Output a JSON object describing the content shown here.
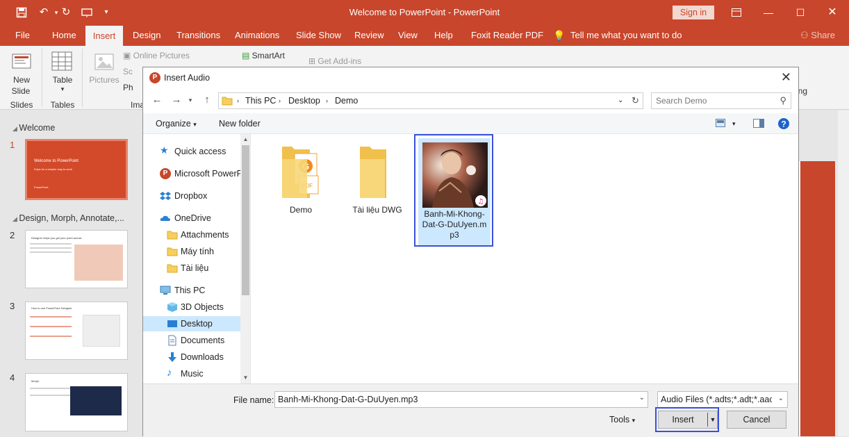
{
  "window": {
    "title": "Welcome to PowerPoint  -  PowerPoint",
    "sign_in": "Sign in"
  },
  "tabs": [
    "File",
    "Home",
    "Insert",
    "Design",
    "Transitions",
    "Animations",
    "Slide Show",
    "Review",
    "View",
    "Help",
    "Foxit Reader PDF",
    "Tell me what you want to do",
    "Share"
  ],
  "ribbon": {
    "new_slide": "New\nSlide",
    "new_slide_line1": "New",
    "new_slide_line2": "Slide",
    "slides_group": "Slides",
    "table": "Table",
    "tables_group": "Tables",
    "pictures": "Pictures",
    "online_pictures": "Online Pictures",
    "sc": "Sc",
    "ph": "Ph",
    "ima": "Ima",
    "smartart": "SmartArt",
    "get_addins": "Get Add-ins",
    "ing": "ing"
  },
  "slides_pane": {
    "sections": [
      "Welcome",
      "Design, Morph, Annotate,..."
    ],
    "slide_numbers": [
      "1",
      "2",
      "3",
      "4"
    ],
    "thumb1_title": "Welcome to PowerPoint",
    "thumb1_sub": "5 tips for a simpler way to work",
    "thumb1_logo": "PowerPoint",
    "thumb2_title": "Designer helps you get your point across",
    "thumb3_title": "How to use PowerPoint Designer",
    "thumb4_title": "Morph"
  },
  "dialog": {
    "title": "Insert Audio",
    "path": [
      "This PC",
      "Desktop",
      "Demo"
    ],
    "search_placeholder": "Search Demo",
    "organize": "Organize",
    "new_folder": "New folder",
    "nav": [
      {
        "label": "Quick access",
        "icon": "star-icon"
      },
      {
        "label": "Microsoft PowerP",
        "icon": "powerpoint-icon"
      },
      {
        "label": "Dropbox",
        "icon": "dropbox-icon"
      },
      {
        "label": "OneDrive",
        "icon": "cloud-icon"
      },
      {
        "label": "Attachments",
        "icon": "folder-icon"
      },
      {
        "label": "Máy tính",
        "icon": "folder-icon"
      },
      {
        "label": "Tài liệu",
        "icon": "folder-icon"
      },
      {
        "label": "This PC",
        "icon": "computer-icon"
      },
      {
        "label": "3D Objects",
        "icon": "cube-icon"
      },
      {
        "label": "Desktop",
        "icon": "desktop-icon"
      },
      {
        "label": "Documents",
        "icon": "document-icon"
      },
      {
        "label": "Downloads",
        "icon": "download-icon"
      },
      {
        "label": "Music",
        "icon": "music-icon"
      }
    ],
    "files": [
      {
        "name": "Demo",
        "type": "folder"
      },
      {
        "name": "Tài liệu DWG",
        "type": "folder"
      },
      {
        "name_lines": [
          "Banh-Mi-Khong-",
          "Dat-G-DuUyen.m",
          "p3"
        ],
        "type": "mp3"
      }
    ],
    "pdf_badge": "PDF",
    "file_name_label": "File name:",
    "file_name_value": "Banh-Mi-Khong-Dat-G-DuUyen.mp3",
    "file_type": "Audio Files (*.adts;*.adt;*.aac;*.",
    "tools": "Tools",
    "insert": "Insert",
    "cancel": "Cancel"
  },
  "colors": {
    "accent": "#c8462b",
    "selection": "#cce8ff",
    "highlight_box": "#3a4fd8"
  }
}
